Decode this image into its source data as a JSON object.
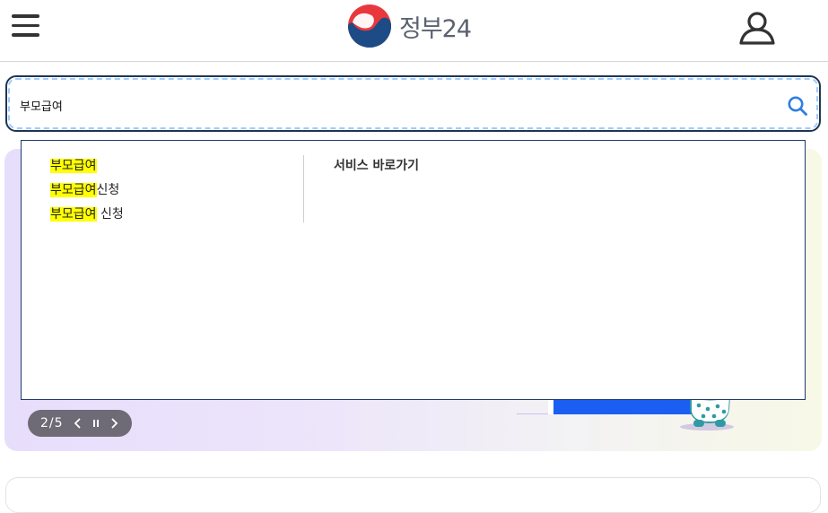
{
  "header": {
    "logo_text": "정부24",
    "brand_colors": {
      "red": "#e8383d",
      "blue": "#1d4b86",
      "text": "#5b6270"
    }
  },
  "search": {
    "value": "부모급여",
    "placeholder": ""
  },
  "autocomplete": {
    "query_highlight": "부모급여",
    "suggestions": [
      {
        "highlight": "부모급여",
        "rest": ""
      },
      {
        "highlight": "부모급여",
        "rest": "신청"
      },
      {
        "highlight": "부모급여",
        "rest": " 신청"
      }
    ],
    "service_title": "서비스 바로가기"
  },
  "banner": {
    "pager": {
      "current": "2",
      "total": "5",
      "label": "2/5"
    },
    "colors": {
      "accent": "#1a5ff2"
    }
  },
  "icons": [
    "menu-icon",
    "logo-emblem-icon",
    "user-icon",
    "search-icon",
    "chevron-left-icon",
    "pause-icon",
    "chevron-right-icon"
  ]
}
